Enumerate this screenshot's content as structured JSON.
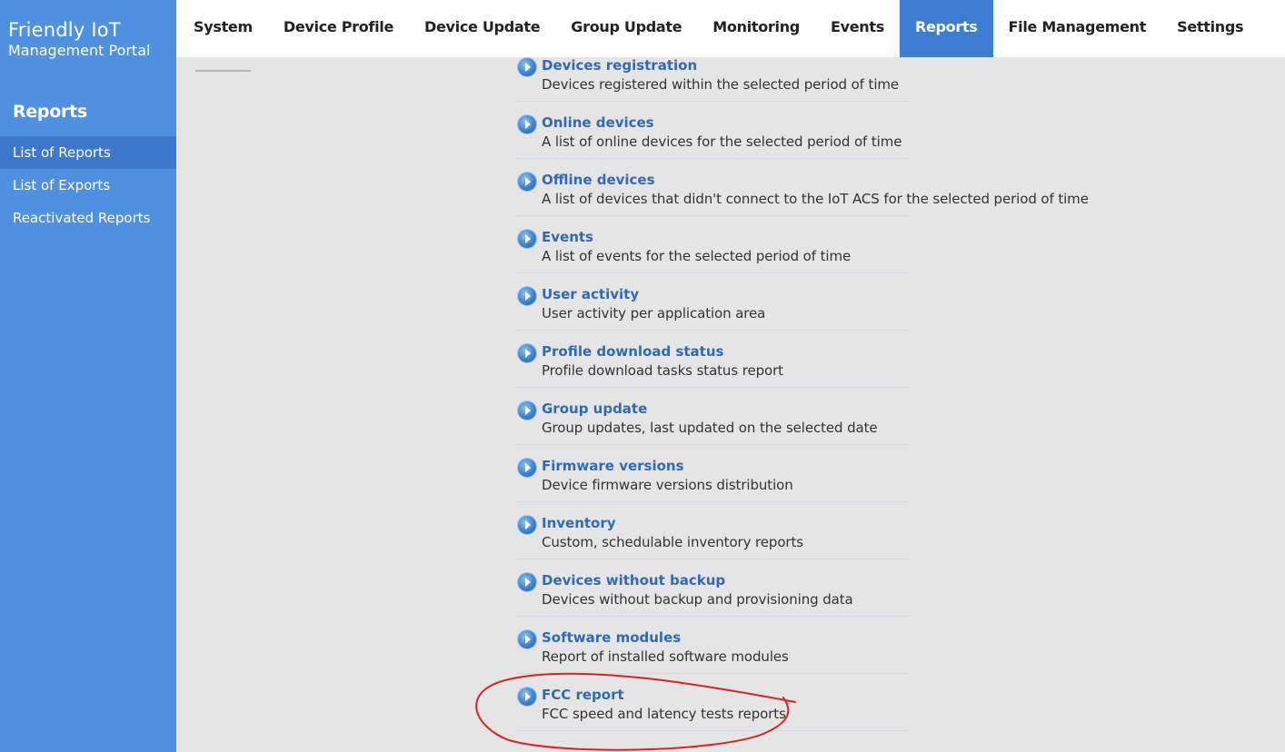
{
  "brand": {
    "line1": "Friendly IoT",
    "line2": "Management Portal"
  },
  "sidebar": {
    "section_title": "Reports",
    "items": [
      {
        "label": "List of Reports",
        "active": true
      },
      {
        "label": "List of Exports",
        "active": false
      },
      {
        "label": "Reactivated Reports",
        "active": false
      }
    ]
  },
  "topnav": {
    "items": [
      {
        "label": "System"
      },
      {
        "label": "Device Profile"
      },
      {
        "label": "Device Update"
      },
      {
        "label": "Group Update"
      },
      {
        "label": "Monitoring"
      },
      {
        "label": "Events"
      },
      {
        "label": "Reports",
        "active": true
      },
      {
        "label": "File Management"
      },
      {
        "label": "Settings"
      }
    ]
  },
  "reports": [
    {
      "title": "Devices registration",
      "description": "Devices registered within the selected period of time"
    },
    {
      "title": "Online devices",
      "description": "A list of online devices for the selected period of time"
    },
    {
      "title": "Offline devices",
      "description": "A list of devices that didn't connect to the IoT ACS for the selected period of time"
    },
    {
      "title": "Events",
      "description": "A list of events for the selected period of time"
    },
    {
      "title": "User activity",
      "description": "User activity per application area"
    },
    {
      "title": "Profile download status",
      "description": "Profile download tasks status report"
    },
    {
      "title": "Group update",
      "description": "Group updates, last updated on the selected date"
    },
    {
      "title": "Firmware versions",
      "description": "Device firmware versions distribution"
    },
    {
      "title": "Inventory",
      "description": "Custom, schedulable inventory reports"
    },
    {
      "title": "Devices without backup",
      "description": "Devices without backup and provisioning data"
    },
    {
      "title": "Software modules",
      "description": "Report of installed software modules"
    },
    {
      "title": "FCC report",
      "description": "FCC speed and latency tests reports"
    }
  ],
  "colors": {
    "sidebar_bg": "#5090e0",
    "sidebar_active": "#3d78cc",
    "nav_active": "#3d7dd1",
    "link": "#2f6ab3",
    "annotation_red": "#e02020"
  },
  "icons": {
    "report_bullet": "arrow-right-circle-icon"
  }
}
